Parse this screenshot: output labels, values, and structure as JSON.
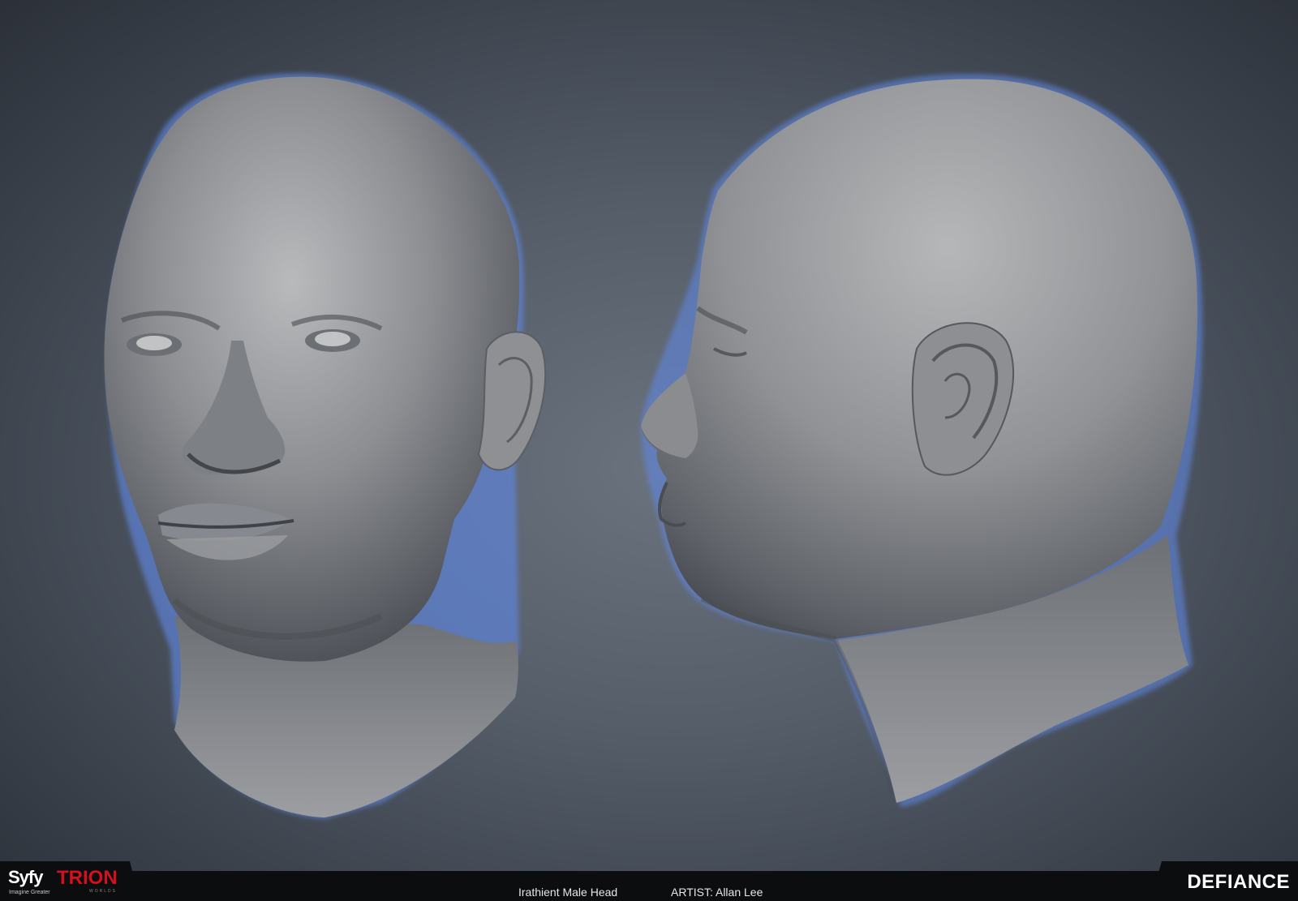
{
  "image": {
    "description_icons": [
      "front-three-quarter-head-sculpt",
      "profile-head-sculpt"
    ]
  },
  "footer": {
    "syfy_logo": "Syfy",
    "syfy_tagline": "Imagine Greater",
    "trion_logo": "TRION",
    "trion_sub": "WORLDS",
    "title": "Irathient Male Head",
    "artist": "ARTIST: Allan Lee",
    "defiance_logo": "DEFIANCE"
  },
  "colors": {
    "background": "#555d69",
    "footer": "#0c0d0f",
    "trion_red": "#d4101d",
    "rim_light": "#5f86e0"
  }
}
